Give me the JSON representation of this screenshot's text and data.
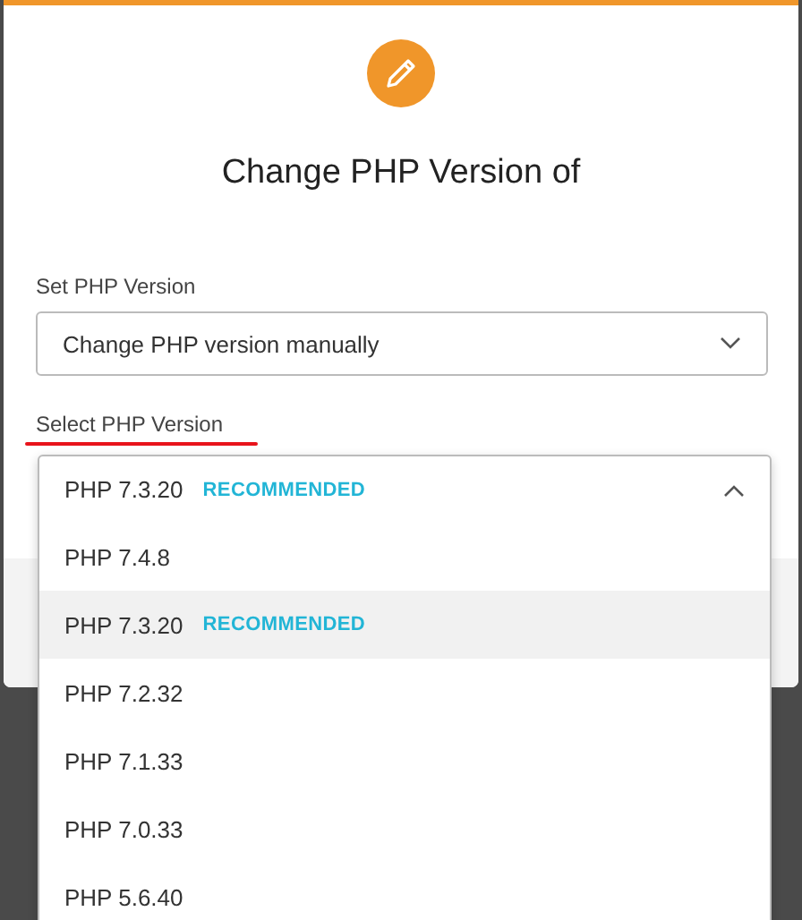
{
  "dialog": {
    "title": "Change PHP Version of",
    "set_field": {
      "label": "Set PHP Version",
      "value": "Change PHP version manually",
      "expanded": false
    },
    "select_field": {
      "label": "Select PHP Version",
      "value": "PHP 7.3.20",
      "badge": "RECOMMENDED",
      "expanded": true,
      "options": [
        {
          "label": "PHP 7.4.8",
          "selected": false
        },
        {
          "label": "PHP 7.3.20",
          "badge": "RECOMMENDED",
          "selected": true
        },
        {
          "label": "PHP 7.2.32",
          "selected": false
        },
        {
          "label": "PHP 7.1.33",
          "selected": false
        },
        {
          "label": "PHP 7.0.33",
          "selected": false
        },
        {
          "label": "PHP 5.6.40",
          "selected": false
        }
      ]
    }
  }
}
